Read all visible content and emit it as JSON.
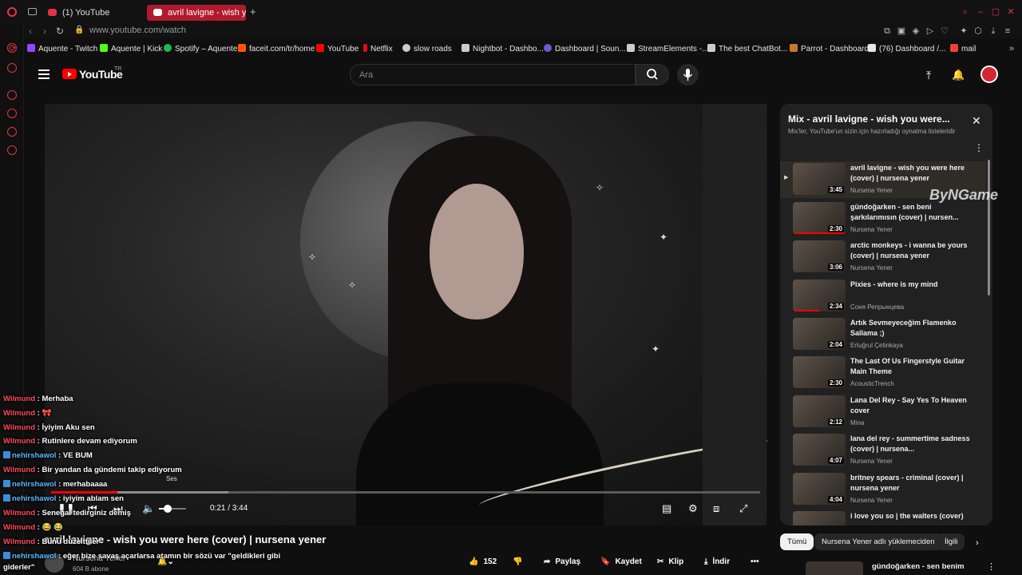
{
  "browser": {
    "tabs": [
      {
        "label": "(1) YouTube"
      },
      {
        "label": "avril lavigne - wish you"
      }
    ],
    "add_tab": "+",
    "url": "www.youtube.com/watch",
    "bookmarks": [
      {
        "label": "Aquente - Twitch",
        "color": "#9146ff"
      },
      {
        "label": "Aquente | Kick",
        "color": "#53fc18"
      },
      {
        "label": "Spotify – Aquente",
        "color": "#1db954"
      },
      {
        "label": "faceit.com/tr/home",
        "color": "#ff5500"
      },
      {
        "label": "YouTube",
        "color": "#ff0000"
      },
      {
        "label": "Netflix",
        "color": "#e50914"
      },
      {
        "label": "slow roads",
        "color": "#cccccc"
      },
      {
        "label": "Nightbot - Dashbo...",
        "color": "#cccccc"
      },
      {
        "label": "Dashboard | Soun...",
        "color": "#6a5acd"
      },
      {
        "label": "StreamElements -...",
        "color": "#cccccc"
      },
      {
        "label": "The best ChatBot...",
        "color": "#cccccc"
      },
      {
        "label": "Parrot - Dashboard",
        "color": "#c47a2c"
      },
      {
        "label": "(76) Dashboard /...",
        "color": "#e6e6e6"
      },
      {
        "label": "mail",
        "color": "#ea4335"
      }
    ]
  },
  "header": {
    "logo_text": "YouTube",
    "region": "TR",
    "search_placeholder": "Ara"
  },
  "player": {
    "time": "0:21 / 3:44",
    "progress": 0.094,
    "buffered": 0.25,
    "volume": 0.35,
    "volume_tooltip": "Ses"
  },
  "video": {
    "title": "avril lavigne - wish you were here (cover) | nursena yener",
    "channel": "Nursena Yener",
    "subscribers": "604 B abone",
    "actions": {
      "likes": "152",
      "share": "Paylaş",
      "save": "Kaydet",
      "clip": "Klip",
      "download": "İndir"
    }
  },
  "chat": [
    {
      "user": "Wilmund",
      "text": "Merhaba",
      "badge": false
    },
    {
      "user": "Wilmund",
      "text": "🎀",
      "badge": false
    },
    {
      "user": "Wilmund",
      "text": "İyiyim Aku sen",
      "badge": false
    },
    {
      "user": "Wilmund",
      "text": "Rutinlere devam ediyorum",
      "badge": false
    },
    {
      "user": "nehirshawol",
      "text": "VE BUM",
      "badge": true
    },
    {
      "user": "Wilmund",
      "text": "Bir yandan da gündemi takip ediyorum",
      "badge": false
    },
    {
      "user": "nehirshawol",
      "text": "merhabaaaa",
      "badge": true
    },
    {
      "user": "nehirshawol",
      "text": "iyiyim ablam sen",
      "badge": true
    },
    {
      "user": "Wilmund",
      "text": "Senegal tedirginiz demiş",
      "badge": false
    },
    {
      "user": "Wilmund",
      "text": "😂 😂",
      "badge": false
    },
    {
      "user": "Wilmund",
      "text": "Bunu düzelttiler",
      "badge": false
    },
    {
      "user": "nehirshawol",
      "text": "eğer bize savaş açarlarsa atamın bir sözü var \"geldikleri gibi giderler\"",
      "badge": true
    }
  ],
  "playlist": {
    "title": "Mix - avril lavigne - wish you were...",
    "subtitle": "Mix'ler, YouTube'un sizin için hazırladığı oynatma listeleridir",
    "items": [
      {
        "title": "avril lavigne - wish you were here (cover) | nursena yener",
        "channel": "Nursena Yener",
        "duration": "3:45",
        "active": true
      },
      {
        "title": "gündoğarken - sen beni şarkılarımısın (cover) | nursen...",
        "channel": "Nursena Yener",
        "duration": "2:30",
        "watched": 1
      },
      {
        "title": "arctic monkeys - i wanna be yours (cover) | nursena yener",
        "channel": "Nursena Yener",
        "duration": "3:06"
      },
      {
        "title": "Pixies - where is my mind",
        "channel": "Соня Репрынцева",
        "duration": "2:34",
        "watched": 0.5
      },
      {
        "title": "Artık Sevmeyeceğim Flamenko Sallama ;)",
        "channel": "Ertuğrul Çetinkaya",
        "duration": "2:04"
      },
      {
        "title": "The Last Of Us Fingerstyle Guitar Main Theme",
        "channel": "AcousticTrench",
        "duration": "2:30"
      },
      {
        "title": "Lana Del Rey - Say Yes To Heaven cover",
        "channel": "Mina",
        "duration": "2:12"
      },
      {
        "title": "lana del rey - summertime sadness (cover) | nursena...",
        "channel": "Nursena Yener",
        "duration": "4:07"
      },
      {
        "title": "britney spears - criminal (cover) | nursena yener",
        "channel": "Nursena Yener",
        "duration": "4:04"
      },
      {
        "title": "i love you so | the walters (cover)",
        "channel": "",
        "duration": ""
      }
    ]
  },
  "chips": [
    "Tümü",
    "Nursena Yener adlı yüklemeciden",
    "İlgili"
  ],
  "next_preview": {
    "title": "gündoğarken - sen benim"
  },
  "watermark": "ByNGame"
}
